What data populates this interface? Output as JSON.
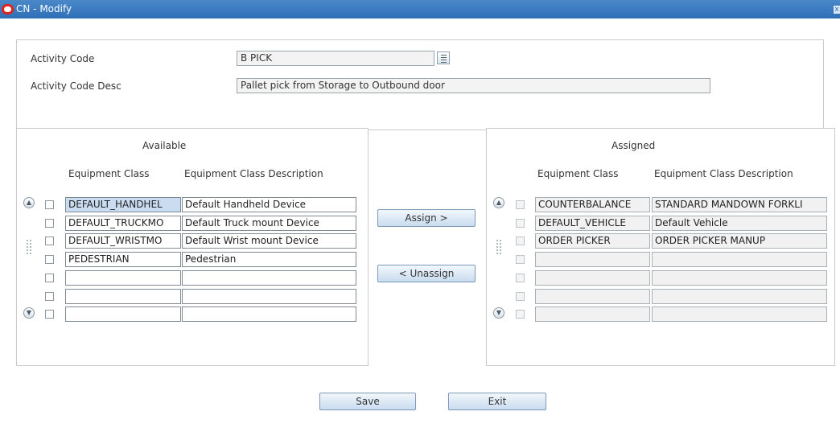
{
  "window": {
    "title": "CN - Modify",
    "close_glyph": "x"
  },
  "header": {
    "activity_code_label": "Activity Code",
    "activity_code_value": "B PICK",
    "activity_desc_label": "Activity Code Desc",
    "activity_desc_value": "Pallet pick from Storage to Outbound door"
  },
  "available": {
    "title": "Available",
    "col_class": "Equipment Class",
    "col_desc": "Equipment Class Description",
    "rows": [
      {
        "cls": "DEFAULT_HANDHEL",
        "desc": "Default Handheld Device"
      },
      {
        "cls": "DEFAULT_TRUCKMO",
        "desc": "Default Truck mount Device"
      },
      {
        "cls": "DEFAULT_WRISTMO",
        "desc": "Default Wrist mount Device"
      },
      {
        "cls": "PEDESTRIAN",
        "desc": "Pedestrian"
      },
      {
        "cls": "",
        "desc": ""
      },
      {
        "cls": "",
        "desc": ""
      },
      {
        "cls": "",
        "desc": ""
      }
    ]
  },
  "assigned": {
    "title": "Assigned",
    "col_class": "Equipment Class",
    "col_desc": "Equipment Class Description",
    "rows": [
      {
        "cls": "COUNTERBALANCE",
        "desc": "STANDARD MANDOWN FORKLI"
      },
      {
        "cls": "DEFAULT_VEHICLE",
        "desc": "Default Vehicle"
      },
      {
        "cls": "ORDER PICKER",
        "desc": "ORDER PICKER MANUP"
      },
      {
        "cls": "",
        "desc": ""
      },
      {
        "cls": "",
        "desc": ""
      },
      {
        "cls": "",
        "desc": ""
      },
      {
        "cls": "",
        "desc": ""
      }
    ]
  },
  "actions": {
    "assign": "Assign >",
    "unassign": "< Unassign",
    "save": "Save",
    "exit": "Exit"
  }
}
